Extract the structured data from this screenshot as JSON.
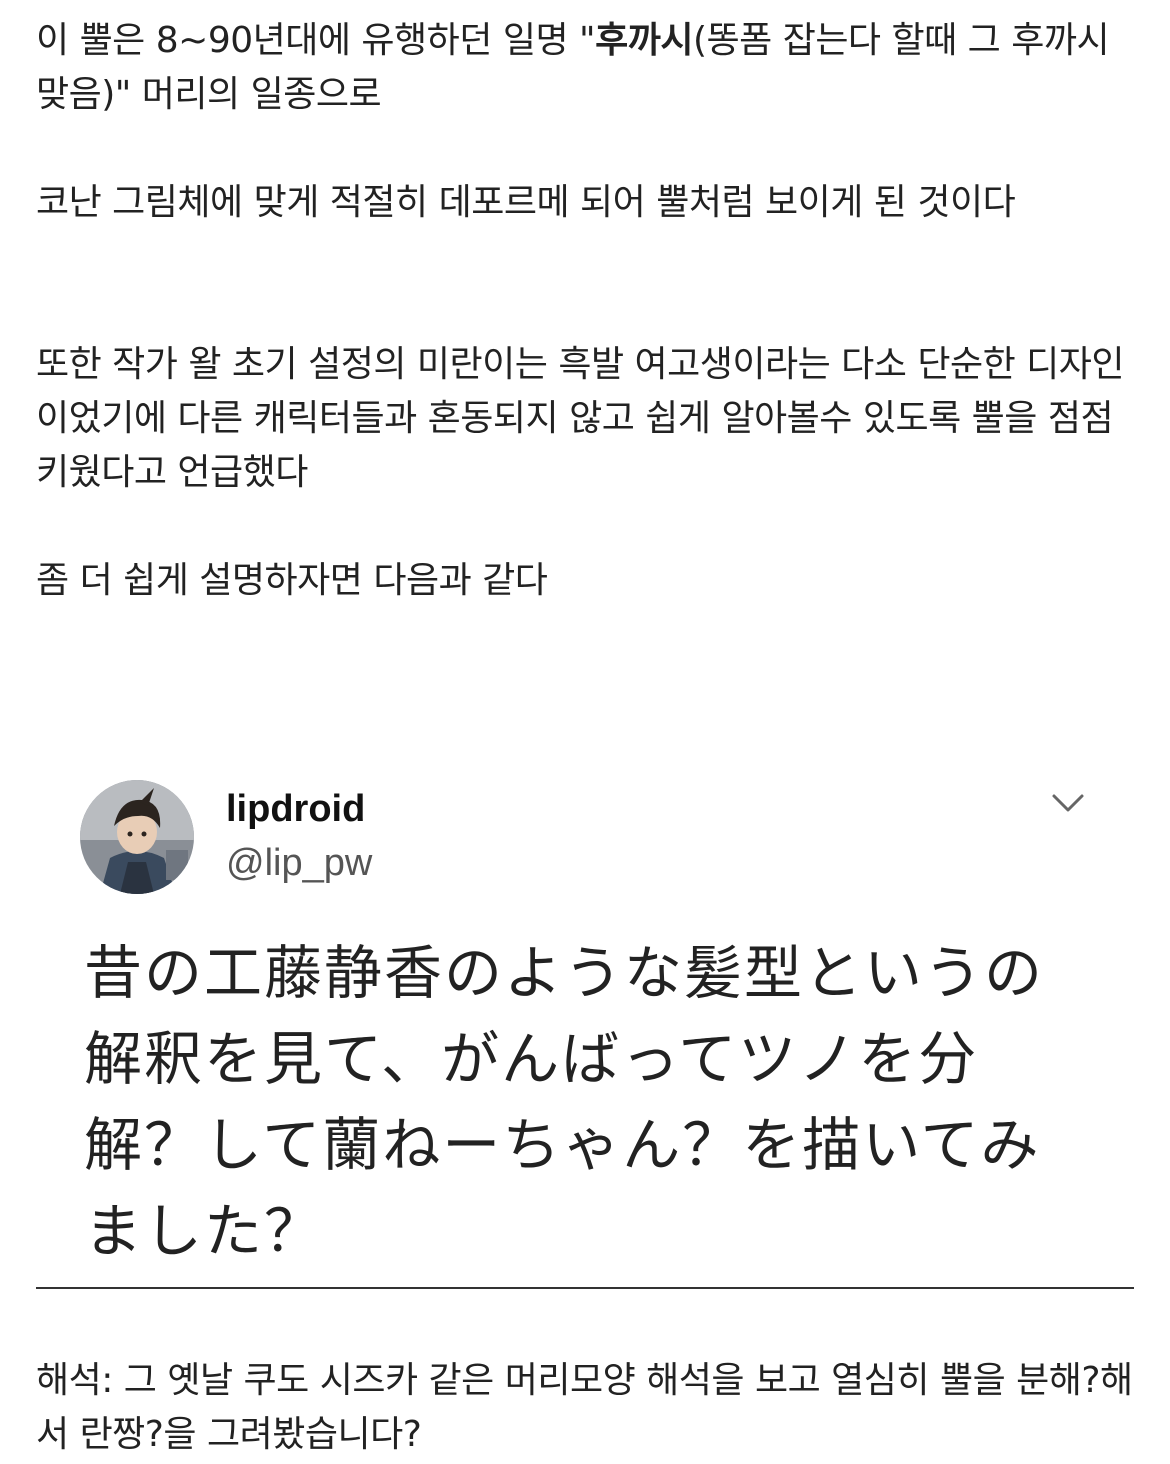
{
  "article": {
    "p1_before": "이 뿔은 8~90년대에 유행하던 일명 \"",
    "p1_bold": "후까시",
    "p1_after": "(똥폼 잡는다 할때 그 후까시 맞음)\" 머리의 일종으로",
    "p2": "코난 그림체에 맞게 적절히 데포르메 되어 뿔처럼 보이게 된 것이다",
    "p3": "또한 작가 왈 초기 설정의 미란이는 흑발 여고생이라는 다소 단순한 디자인이었기에 다른 캐릭터들과 혼동되지 않고 쉽게 알아볼수 있도록 뿔을 점점 키웠다고 언급했다",
    "p4": "좀 더 쉽게 설명하자면 다음과 같다"
  },
  "tweet": {
    "display_name": "lipdroid",
    "handle": "@lip_pw",
    "menu_icon": "chevron-down-icon",
    "text": "昔の工藤静香のような髪型というの解釈を見て、がんばってツノを分解？して蘭ねーちゃん？を描いてみました？"
  },
  "translation": {
    "text": "해석: 그 옛날 쿠도 시즈카 같은 머리모양 해석을 보고 열심히 뿔을 분해?해서 란짱?을 그려봤습니다?"
  }
}
